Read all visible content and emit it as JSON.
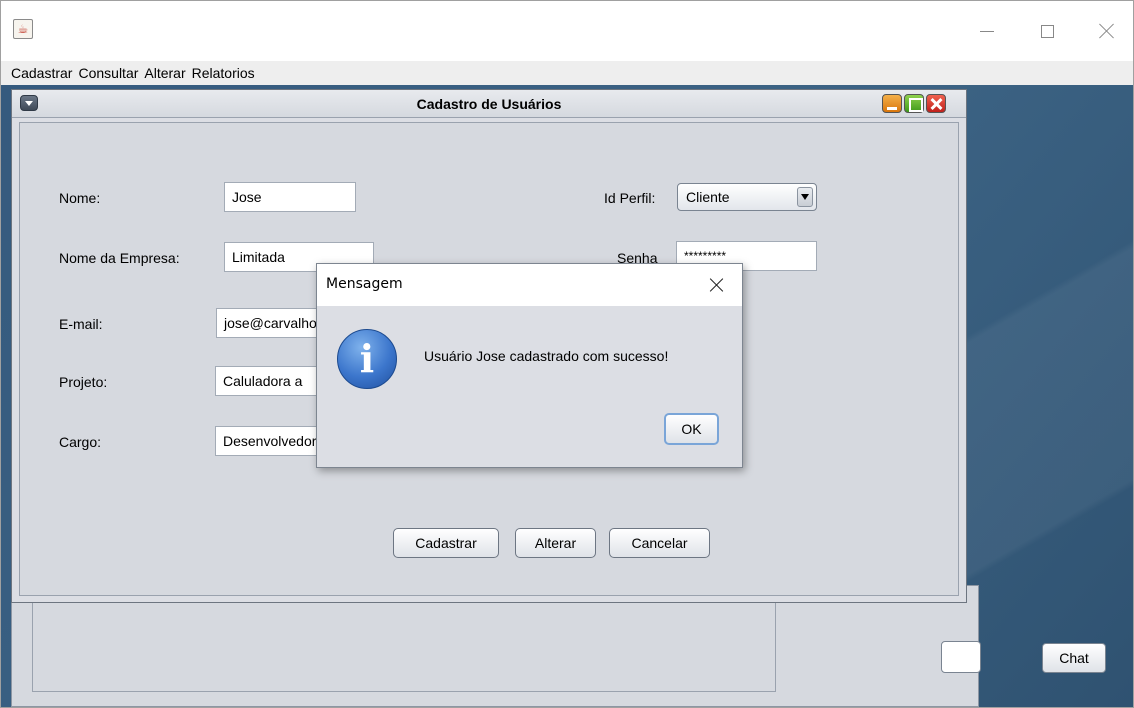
{
  "menubar": {
    "items": [
      "Cadastrar",
      "Consultar",
      "Alterar",
      "Relatorios"
    ]
  },
  "frame": {
    "title": "Cadastro de Usuários",
    "form": {
      "nome_label": "Nome:",
      "nome_value": "Jose",
      "empresa_label": "Nome da Empresa:",
      "empresa_value": "Limitada",
      "email_label": "E-mail:",
      "email_value": "jose@carvalho",
      "projeto_label": "Projeto:",
      "projeto_value": "Caluladora a",
      "cargo_label": "Cargo:",
      "cargo_value": "Desenvolvedor",
      "perfil_label": "Id Perfil:",
      "perfil_value": "Cliente",
      "senha_label": "Senha",
      "senha_value": "*********"
    },
    "buttons": {
      "cadastrar": "Cadastrar",
      "alterar": "Alterar",
      "cancelar": "Cancelar"
    }
  },
  "background": {
    "chat_label": "Chat"
  },
  "dialog": {
    "title": "Mensagem",
    "message": "Usuário Jose cadastrado com sucesso!",
    "ok_label": "OK",
    "icon_glyph": "i"
  },
  "colors": {
    "desktop": "#3c6384",
    "frame_bg": "#d6d9df",
    "info_icon": "#3c76cc"
  }
}
